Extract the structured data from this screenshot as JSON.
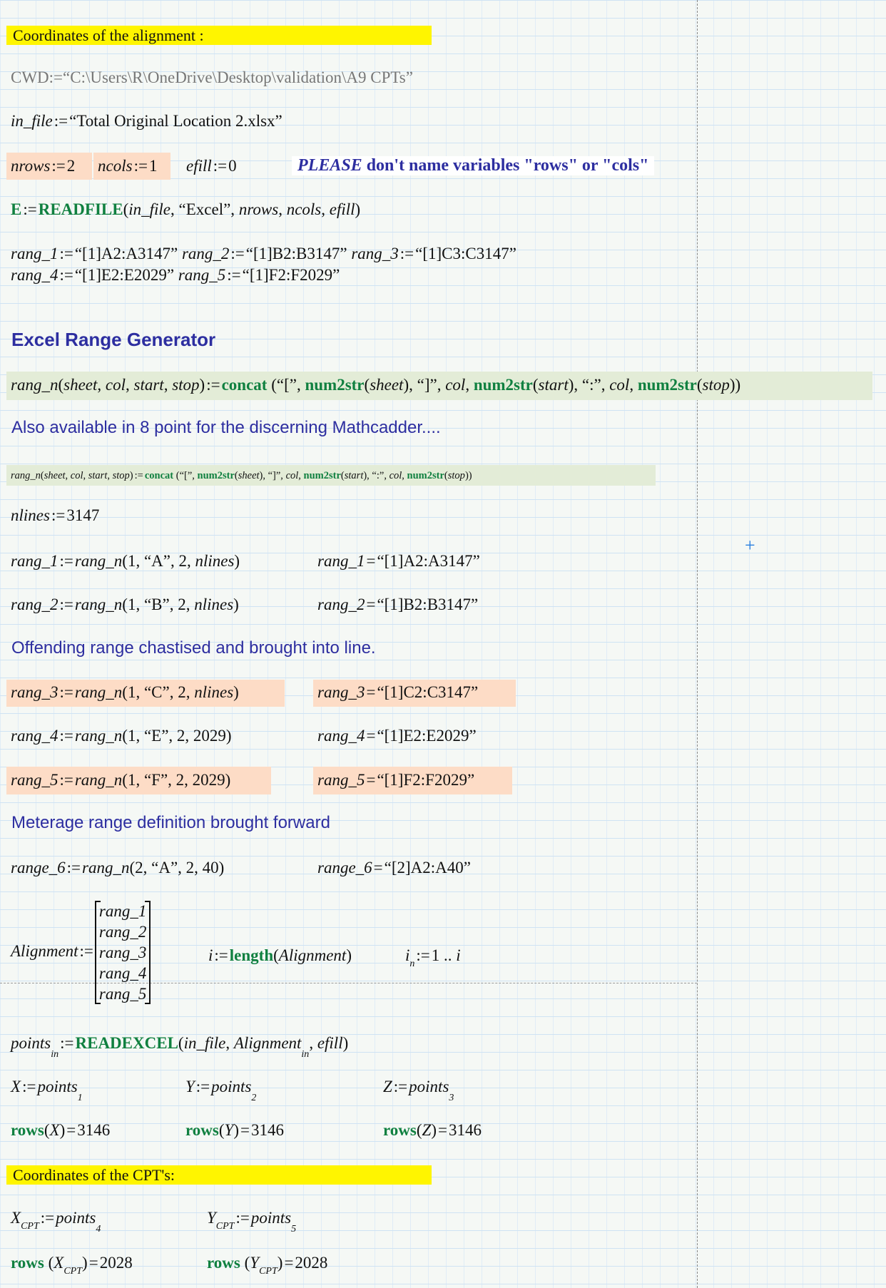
{
  "headers": {
    "alignment": "Coordinates of the alignment :",
    "cpt": "Coordinates of the CPT's:"
  },
  "cwd": [
    [
      "CWD",
      "g"
    ],
    [
      ":=",
      "g"
    ],
    [
      "“C:\\Users\\R\\OneDrive\\Desktop\\validation\\A9 CPTs”",
      "g"
    ]
  ],
  "in_file": [
    [
      "in_file",
      "v"
    ],
    [
      ":=",
      "o"
    ],
    [
      "“Total Original Location 2.xlsx”",
      "t"
    ]
  ],
  "nrows": [
    [
      "nrows",
      "v"
    ],
    [
      ":=",
      "o"
    ],
    [
      "2",
      "t"
    ]
  ],
  "ncols": [
    [
      "ncols",
      "v"
    ],
    [
      ":=",
      "o"
    ],
    [
      "1",
      "t"
    ]
  ],
  "efill": [
    [
      "efill",
      "v"
    ],
    [
      ":=",
      "o"
    ],
    [
      "0",
      "t"
    ]
  ],
  "notes": {
    "please_em": "PLEASE",
    "please_rest": " don't name variables \"rows\" or \"cols\"",
    "excel_range_generator": "Excel Range Generator",
    "also_available": "Also available in 8 point for the discerning Mathcadder....",
    "offending": "Offending range chastised and brought into line.",
    "meterage": "Meterage  range definition brought forward"
  },
  "readfile": [
    [
      "E",
      "f"
    ],
    [
      ":=",
      "o"
    ],
    [
      "READFILE",
      "f"
    ],
    [
      "(",
      "t"
    ],
    [
      "in_file",
      "v"
    ],
    [
      ", “Excel”, ",
      "t"
    ],
    [
      "nrows",
      "v"
    ],
    [
      ", ",
      "t"
    ],
    [
      "ncols",
      "v"
    ],
    [
      ", ",
      "t"
    ],
    [
      "efill",
      "v"
    ],
    [
      ")",
      "t"
    ]
  ],
  "rangdef1": [
    [
      "rang_1",
      "v"
    ],
    [
      ":=",
      "o"
    ],
    [
      "“[1]A2:A3147”  ",
      "t"
    ],
    [
      "rang_2",
      "v"
    ],
    [
      ":=",
      "o"
    ],
    [
      "“[1]B2:B3147”  ",
      "t"
    ],
    [
      "rang_3",
      "v"
    ],
    [
      ":=",
      "o"
    ],
    [
      "“[1]C3:C3147”",
      "t"
    ]
  ],
  "rangdef2": [
    [
      "rang_4",
      "v"
    ],
    [
      ":=",
      "o"
    ],
    [
      "“[1]E2:E2029”  ",
      "t"
    ],
    [
      "rang_5",
      "v"
    ],
    [
      ":=",
      "o"
    ],
    [
      "“[1]F2:F2029”",
      "t"
    ]
  ],
  "rangn": [
    [
      "rang_n",
      "v"
    ],
    [
      "(",
      "t"
    ],
    [
      "sheet",
      "v"
    ],
    [
      ", ",
      "t"
    ],
    [
      "col",
      "v"
    ],
    [
      ", ",
      "t"
    ],
    [
      "start",
      "v"
    ],
    [
      ", ",
      "t"
    ],
    [
      "stop",
      "v"
    ],
    [
      ")",
      "t"
    ],
    [
      ":=",
      "o"
    ],
    [
      "concat",
      "f"
    ],
    [
      " (“[”, ",
      "t"
    ],
    [
      "num2str",
      "f"
    ],
    [
      "(",
      "t"
    ],
    [
      "sheet",
      "v"
    ],
    [
      "), “]”, ",
      "t"
    ],
    [
      "col",
      "v"
    ],
    [
      ", ",
      "t"
    ],
    [
      "num2str",
      "f"
    ],
    [
      "(",
      "t"
    ],
    [
      "start",
      "v"
    ],
    [
      "), “:”, ",
      "t"
    ],
    [
      "col",
      "v"
    ],
    [
      ", ",
      "t"
    ],
    [
      "num2str",
      "f"
    ],
    [
      "(",
      "t"
    ],
    [
      "stop",
      "v"
    ],
    [
      "))",
      "t"
    ]
  ],
  "nlines": [
    [
      "nlines",
      "v"
    ],
    [
      ":=",
      "o"
    ],
    [
      "3147",
      "t"
    ]
  ],
  "calls": [
    {
      "def": [
        [
          "rang_1",
          "v"
        ],
        [
          ":=",
          "o"
        ],
        [
          "rang_n",
          "v"
        ],
        [
          "(1, “A”, 2, ",
          "t"
        ],
        [
          "nlines",
          "v"
        ],
        [
          ")",
          "t"
        ]
      ],
      "res": [
        [
          "rang_1",
          "v"
        ],
        [
          "=",
          "o"
        ],
        [
          "“[1]A2:A3147”",
          "t"
        ]
      ]
    },
    {
      "def": [
        [
          "rang_2",
          "v"
        ],
        [
          ":=",
          "o"
        ],
        [
          "rang_n",
          "v"
        ],
        [
          "(1, “B”, 2, ",
          "t"
        ],
        [
          "nlines",
          "v"
        ],
        [
          ")",
          "t"
        ]
      ],
      "res": [
        [
          "rang_2",
          "v"
        ],
        [
          "=",
          "o"
        ],
        [
          "“[1]B2:B3147”",
          "t"
        ]
      ]
    },
    {
      "def": [
        [
          "rang_3",
          "v"
        ],
        [
          ":=",
          "o"
        ],
        [
          "rang_n",
          "v"
        ],
        [
          "(1, “C”, 2, ",
          "t"
        ],
        [
          "nlines",
          "v"
        ],
        [
          ")",
          "t"
        ]
      ],
      "res": [
        [
          "rang_3",
          "v"
        ],
        [
          "=",
          "o"
        ],
        [
          "“[1]C2:C3147”",
          "t"
        ]
      ]
    },
    {
      "def": [
        [
          "rang_4",
          "v"
        ],
        [
          ":=",
          "o"
        ],
        [
          "rang_n",
          "v"
        ],
        [
          "(1, “E”, 2, 2029)",
          "t"
        ]
      ],
      "res": [
        [
          "rang_4",
          "v"
        ],
        [
          "=",
          "o"
        ],
        [
          "“[1]E2:E2029”",
          "t"
        ]
      ]
    },
    {
      "def": [
        [
          "rang_5",
          "v"
        ],
        [
          ":=",
          "o"
        ],
        [
          "rang_n",
          "v"
        ],
        [
          "(1, “F”, 2, 2029)",
          "t"
        ]
      ],
      "res": [
        [
          "rang_5",
          "v"
        ],
        [
          "=",
          "o"
        ],
        [
          "“[1]F2:F2029”",
          "t"
        ]
      ]
    },
    {
      "def": [
        [
          "range_6",
          "v"
        ],
        [
          ":=",
          "o"
        ],
        [
          "rang_n",
          "v"
        ],
        [
          "(2, “A”, 2, 40)",
          "t"
        ]
      ],
      "res": [
        [
          "range_6",
          "v"
        ],
        [
          "=",
          "o"
        ],
        [
          "“[2]A2:A40”",
          "t"
        ]
      ]
    }
  ],
  "alignment": {
    "name": "Alignment",
    "op": ":=",
    "items": [
      "rang_1",
      "rang_2",
      "rang_3",
      "rang_4",
      "rang_5"
    ]
  },
  "length": [
    [
      "i",
      "v"
    ],
    [
      ":=",
      "o"
    ],
    [
      "length",
      "f"
    ],
    [
      "(",
      "t"
    ],
    [
      "Alignment",
      "v"
    ],
    [
      ")",
      "t"
    ]
  ],
  "range_def": [
    [
      "i",
      "v"
    ],
    [
      "n",
      "sub2"
    ],
    [
      ":=",
      "o"
    ],
    [
      "1 .. ",
      "t"
    ],
    [
      "i",
      "v"
    ]
  ],
  "points": [
    [
      "points",
      "v"
    ],
    [
      "in",
      "sub"
    ],
    [
      ":=",
      "o"
    ],
    [
      "READEXCEL",
      "f"
    ],
    [
      "(",
      "t"
    ],
    [
      "in_file",
      "v"
    ],
    [
      ", ",
      "t"
    ],
    [
      "Alignment",
      "v"
    ],
    [
      "in",
      "sub"
    ],
    [
      ", ",
      "t"
    ],
    [
      "efill",
      "v"
    ],
    [
      ")",
      "t"
    ]
  ],
  "xyz": [
    [
      [
        "X",
        "v"
      ],
      [
        ":=",
        "o"
      ],
      [
        "points",
        "v"
      ],
      [
        "1",
        "sub"
      ]
    ],
    [
      [
        "Y",
        "v"
      ],
      [
        ":=",
        "o"
      ],
      [
        "points",
        "v"
      ],
      [
        "2",
        "sub"
      ]
    ],
    [
      [
        "Z",
        "v"
      ],
      [
        ":=",
        "o"
      ],
      [
        "points",
        "v"
      ],
      [
        "3",
        "sub"
      ]
    ]
  ],
  "rows": [
    [
      [
        "rows",
        "f"
      ],
      [
        "(",
        "t"
      ],
      [
        "X",
        "v"
      ],
      [
        ")",
        "t"
      ],
      [
        "=",
        "o"
      ],
      [
        "3146",
        "t"
      ]
    ],
    [
      [
        "rows",
        "f"
      ],
      [
        "(",
        "t"
      ],
      [
        "Y",
        "v"
      ],
      [
        ")",
        "t"
      ],
      [
        "=",
        "o"
      ],
      [
        "3146",
        "t"
      ]
    ],
    [
      [
        "rows",
        "f"
      ],
      [
        "(",
        "t"
      ],
      [
        "Z",
        "v"
      ],
      [
        ")",
        "t"
      ],
      [
        "=",
        "o"
      ],
      [
        "3146",
        "t"
      ]
    ]
  ],
  "cpt": [
    [
      [
        "X",
        "v"
      ],
      [
        "CPT",
        "sub2"
      ],
      [
        ":=",
        "o"
      ],
      [
        "points",
        "v"
      ],
      [
        "4",
        "sub"
      ]
    ],
    [
      [
        "Y",
        "v"
      ],
      [
        "CPT",
        "sub2"
      ],
      [
        ":=",
        "o"
      ],
      [
        "points",
        "v"
      ],
      [
        "5",
        "sub"
      ]
    ]
  ],
  "cpt_rows": [
    [
      [
        "rows",
        "f"
      ],
      [
        " (",
        "t"
      ],
      [
        "X",
        "v"
      ],
      [
        "CPT",
        "sub2"
      ],
      [
        ")",
        "t"
      ],
      [
        "=",
        "o"
      ],
      [
        "2028",
        "t"
      ]
    ],
    [
      [
        "rows",
        "f"
      ],
      [
        " (",
        "t"
      ],
      [
        "Y",
        "v"
      ],
      [
        "CPT",
        "sub2"
      ],
      [
        ")",
        "t"
      ],
      [
        "=",
        "o"
      ],
      [
        "2028",
        "t"
      ]
    ]
  ],
  "colors": {
    "highlight": "#fff500",
    "function": "#108040",
    "note": "#2d2ea0",
    "input_highlight": "#fddcc6",
    "definition_bg": "#e3ecd7"
  }
}
